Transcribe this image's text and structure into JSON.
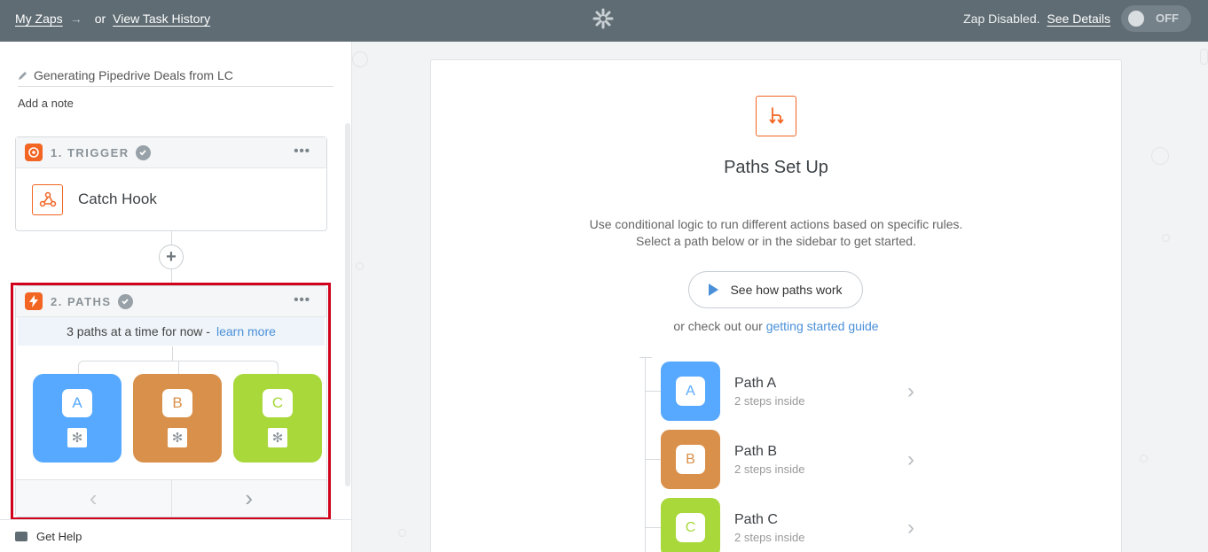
{
  "topbar": {
    "my_zaps": "My Zaps",
    "arrow": "→",
    "or": "or",
    "task_history": "View Task History",
    "status": "Zap Disabled.",
    "see_details": "See Details",
    "toggle_label": "OFF"
  },
  "sidebar": {
    "zap_name": "Generating Pipedrive Deals from LC",
    "add_note": "Add a note",
    "trigger": {
      "title": "1. TRIGGER",
      "app": "Catch Hook",
      "more": "•••"
    },
    "paths": {
      "title": "2. PATHS",
      "more": "•••",
      "notice": "3 paths at a time for now -",
      "learn_more": "learn more",
      "items": [
        {
          "letter": "A",
          "color": "#57a9ff"
        },
        {
          "letter": "B",
          "color": "#d9904a"
        },
        {
          "letter": "C",
          "color": "#a8d83a"
        }
      ],
      "prev": "‹",
      "next": "›"
    },
    "help": "Get Help"
  },
  "main": {
    "title": "Paths Set Up",
    "desc_line1": "Use conditional logic to run different actions based on specific rules.",
    "desc_line2": "Select a path below or in the sidebar to get started.",
    "how_button": "See how paths work",
    "guide_prefix": "or check out our",
    "guide_link": "getting started guide",
    "paths": [
      {
        "letter": "A",
        "name": "Path A",
        "sub": "2 steps inside",
        "color": "#57a9ff"
      },
      {
        "letter": "B",
        "name": "Path B",
        "sub": "2 steps inside",
        "color": "#d9904a"
      },
      {
        "letter": "C",
        "name": "Path C",
        "sub": "2 steps inside",
        "color": "#a8d83a"
      }
    ]
  },
  "colors": {
    "accent": "#f26522",
    "link": "#4a90d9",
    "highlight": "#d0021b",
    "topbar": "#5f6c73"
  }
}
